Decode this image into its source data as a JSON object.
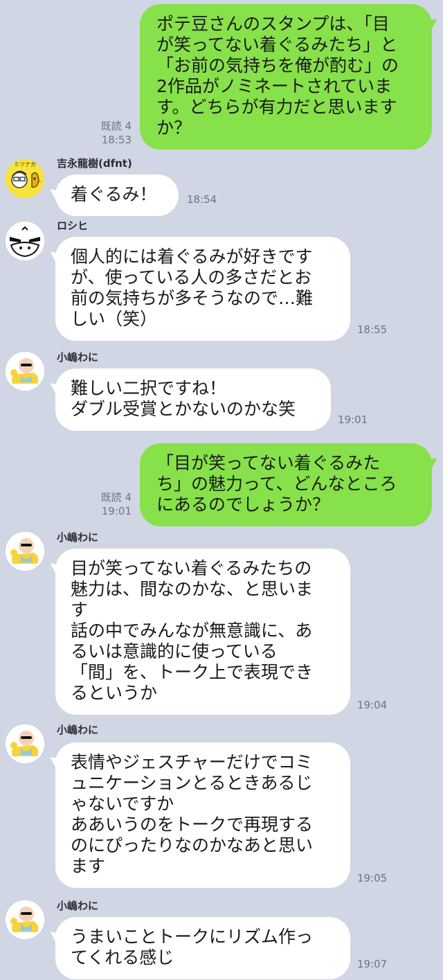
{
  "colors": {
    "background": "#d0d6e3",
    "outgoing_bubble": "#87e14a",
    "incoming_bubble": "#ffffff"
  },
  "messages": [
    {
      "direction": "out",
      "read_label": "既読 4",
      "time": "18:53",
      "lines": [
        "ポテ豆さんのスタンプは、「目",
        "が笑ってない着ぐるみたち」と",
        "「お前の気持ちを俺が酌む」の",
        "2作品がノミネートされていま",
        "す。どちらが有力だと思います",
        "か？"
      ]
    },
    {
      "direction": "in",
      "sender": "吉永龍樹(dfnt)",
      "avatar": "yoshinaga-avatar",
      "avatar_text": "ミツナガ",
      "time": "18:54",
      "lines": [
        "着ぐるみ！"
      ]
    },
    {
      "direction": "in",
      "sender": "ロシヒ",
      "avatar": "roshihi-avatar",
      "time": "18:55",
      "lines": [
        "個人的には着ぐるみが好きです",
        "が、使っている人の多さだとお",
        "前の気持ちが多そうなので…難",
        "しい（笑）"
      ]
    },
    {
      "direction": "in",
      "sender": "小嶋わに",
      "avatar": "kojima-avatar",
      "time": "19:01",
      "lines": [
        "難しい二択ですね！",
        "ダブル受賞とかないのかな笑"
      ]
    },
    {
      "direction": "out",
      "read_label": "既読 4",
      "time": "19:01",
      "lines": [
        "「目が笑ってない着ぐるみた",
        "ち」の魅力って、どんなところ",
        "にあるのでしょうか？"
      ]
    },
    {
      "direction": "in",
      "sender": "小嶋わに",
      "avatar": "kojima-avatar",
      "time": "19:04",
      "lines": [
        "目が笑ってない着ぐるみたちの",
        "魅力は、間なのかな、と思いま",
        "す",
        "話の中でみんなが無意識に、あ",
        "るいは意識的に使っている",
        "「間」を、トーク上で表現でき",
        "るというか"
      ]
    },
    {
      "direction": "in",
      "sender": "小嶋わに",
      "avatar": "kojima-avatar",
      "time": "19:05",
      "lines": [
        "表情やジェスチャーだけでコミ",
        "ュニケーションとるときあるじ",
        "ゃないですか",
        "ああいうのをトークで再現する",
        "のにぴったりなのかなあと思い",
        "ます"
      ]
    },
    {
      "direction": "in",
      "sender": "小嶋わに",
      "avatar": "kojima-avatar",
      "time": "19:07",
      "lines": [
        "うまいことトークにリズム作っ",
        "てくれる感じ"
      ]
    }
  ]
}
